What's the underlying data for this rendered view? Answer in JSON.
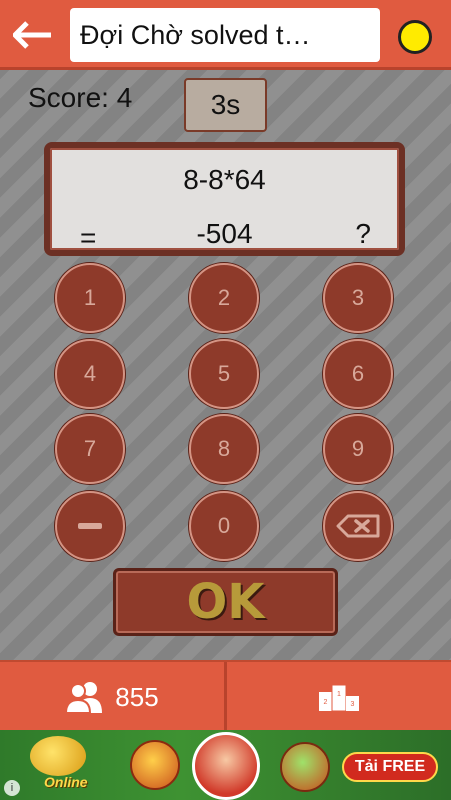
{
  "header": {
    "title": "Đợi Chờ solved t…",
    "status_color": "#ffeb00",
    "back_icon": "arrow-left-icon"
  },
  "game": {
    "score_label": "Score: 4",
    "timer": "3s",
    "expression": "8-8*64",
    "equals": "=",
    "answer": "-504",
    "answer_placeholder": "?"
  },
  "keypad": {
    "keys": [
      "1",
      "2",
      "3",
      "4",
      "5",
      "6",
      "7",
      "8",
      "9",
      "−",
      "0",
      "⌫"
    ],
    "ok_label": "OK"
  },
  "footer": {
    "players_count": "855",
    "players_icon": "users-icon",
    "rank_icon": "podium-icon"
  },
  "ad": {
    "online_label": "Online",
    "cta_label": "Tải FREE",
    "info_label": "i"
  },
  "colors": {
    "accent": "#e05b40",
    "key_bg": "#8e3a2a",
    "ok_text": "#b79a3a"
  }
}
